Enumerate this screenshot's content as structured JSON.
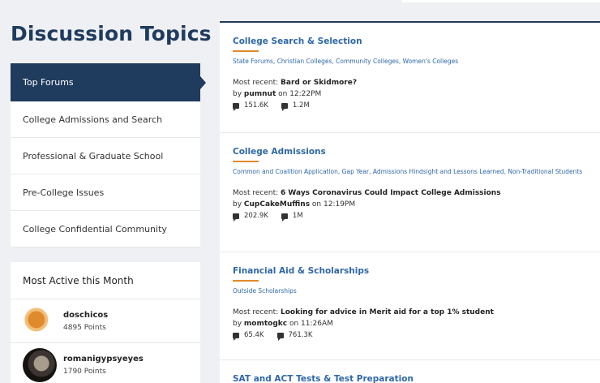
{
  "page_title": "Discussion Topics",
  "nav": [
    {
      "label": "Top Forums",
      "active": true
    },
    {
      "label": "College Admissions and Search",
      "active": false
    },
    {
      "label": "Professional & Graduate School",
      "active": false
    },
    {
      "label": "Pre-College Issues",
      "active": false
    },
    {
      "label": "College Confidential Community",
      "active": false
    }
  ],
  "most_active": {
    "title": "Most Active this Month",
    "users": [
      {
        "name": "doschicos",
        "points": "4895 Points"
      },
      {
        "name": "romanigypsyeyes",
        "points": "1790 Points"
      }
    ]
  },
  "topics": [
    {
      "title": "College Search & Selection",
      "subs": "State Forums, Christian Colleges, Community Colleges, Women's Colleges",
      "recent_label": "Most recent: ",
      "recent_thread": "Bard or Skidmore?",
      "by_label": "by ",
      "author": "pumnut",
      "time": " on 12:22PM",
      "discussions": "151.6K",
      "comments": "1.2M"
    },
    {
      "title": "College Admissions",
      "subs": "Common and Coalition Application, Gap Year, Admissions Hindsight and Lessons Learned, Non-Traditional Students",
      "recent_label": "Most recent: ",
      "recent_thread": "6 Ways Coronavirus Could Impact College Admissions",
      "by_label": "by ",
      "author": "CupCakeMuffins",
      "time": " on 12:19PM",
      "discussions": "202.9K",
      "comments": "1M"
    },
    {
      "title": "Financial Aid & Scholarships",
      "subs": "Outside Scholarships",
      "recent_label": "Most recent: ",
      "recent_thread": "Looking for advice in Merit aid for a top 1% student",
      "by_label": "by ",
      "author": "momtogkc",
      "time": " on 11:26AM",
      "discussions": "65.4K",
      "comments": "761.3K"
    },
    {
      "title": "SAT and ACT Tests & Test Preparation"
    }
  ],
  "colors": {
    "navy": "#1f3b5e",
    "link": "#2f67a8",
    "accent": "#e08a2e"
  }
}
